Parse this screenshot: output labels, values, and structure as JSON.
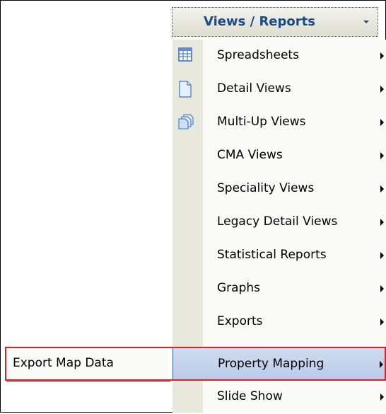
{
  "menu_trigger": {
    "label": "Views / Reports",
    "caret_icon": "chevron-down-icon"
  },
  "menu": {
    "items": [
      {
        "label": "Spreadsheets",
        "icon": "spreadsheet-icon",
        "has_submenu": true
      },
      {
        "label": "Detail Views",
        "icon": "document-icon",
        "has_submenu": true
      },
      {
        "label": "Multi-Up Views",
        "icon": "multi-document-icon",
        "has_submenu": true
      },
      {
        "label": "CMA Views",
        "icon": "",
        "has_submenu": true
      },
      {
        "label": "Speciality Views",
        "icon": "",
        "has_submenu": true
      },
      {
        "label": "Legacy Detail Views",
        "icon": "",
        "has_submenu": true
      },
      {
        "label": "Statistical Reports",
        "icon": "",
        "has_submenu": true
      },
      {
        "label": "Graphs",
        "icon": "",
        "has_submenu": true
      },
      {
        "label": "Exports",
        "icon": "",
        "has_submenu": true
      },
      {
        "label": "Property Mapping",
        "icon": "",
        "has_submenu": true,
        "highlighted": true
      },
      {
        "label": "Slide Show",
        "icon": "",
        "has_submenu": true
      }
    ]
  },
  "submenu": {
    "items": [
      {
        "label": "Export Map Data"
      }
    ]
  },
  "colors": {
    "highlight_border": "#e01b2a",
    "trigger_text": "#1a4a8a",
    "menu_gutter": "#e9e8dc",
    "selected_item": "#b8cbe8"
  }
}
